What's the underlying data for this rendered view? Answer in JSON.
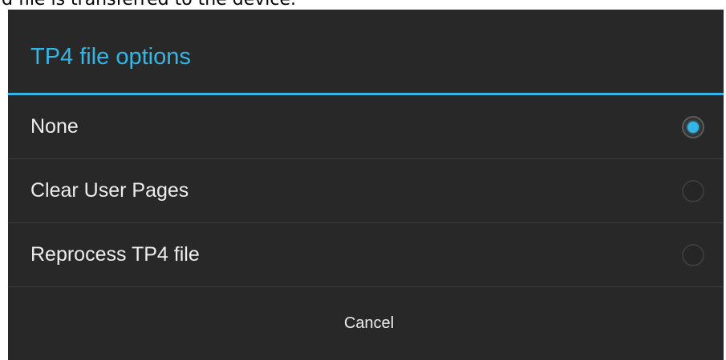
{
  "caption": "d file is transferred to the device.",
  "dialog": {
    "title": "TP4 file options",
    "options": [
      {
        "label": "None",
        "selected": true
      },
      {
        "label": "Clear User Pages",
        "selected": false
      },
      {
        "label": "Reprocess TP4 file",
        "selected": false
      }
    ],
    "cancel_label": "Cancel"
  },
  "colors": {
    "accent": "#33b5e5",
    "dialog_background": "#282828",
    "text": "#ededed"
  }
}
